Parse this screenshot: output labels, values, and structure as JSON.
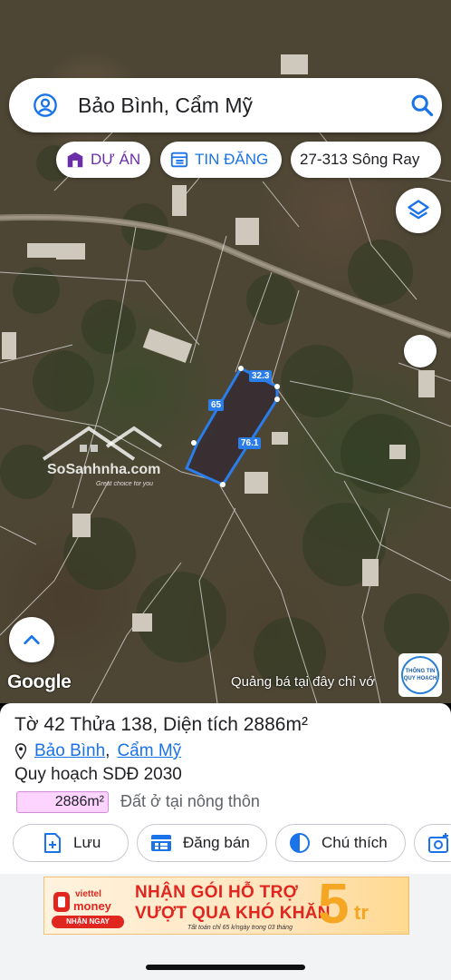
{
  "search": {
    "query": "Bảo Bình, Cẩm Mỹ"
  },
  "chips": {
    "du_an": "DỰ ÁN",
    "tin_dang": "TIN ĐĂNG",
    "address": "27-313 Sông Ray"
  },
  "map": {
    "google_label": "Google",
    "ad_text": "Quảng bá tại đây chỉ vớ",
    "badge_line1": "THÔNG TIN",
    "badge_line2": "QUY HOẠCH",
    "parcel_dims": {
      "top": "32.3",
      "left": "65",
      "right": "76.1"
    },
    "watermark_name": "SoSanhnha.com",
    "watermark_slogan": "Great choice for you",
    "parcel_color": "#2b7de9"
  },
  "parcel": {
    "title": "Tờ 42 Thửa 138, Diện tích 2886m²",
    "commune": "Bảo Bình",
    "separator": ",",
    "district": "Cẩm Mỹ",
    "plan_label": "Quy hoạch SDĐ 2030",
    "area_tag": "2886m²",
    "land_type": "Đất ở tại nông thôn",
    "area_tag_color": "#fcd4ff"
  },
  "actions": {
    "save": "Lưu",
    "post_sale": "Đăng bán",
    "legend": "Chú thích"
  },
  "banner": {
    "brand_line1": "viettel",
    "brand_line2": "money",
    "cta": "NHẬN NGAY",
    "line1": "NHẬN GÓI HỖ TRỢ",
    "line2": "VƯỢT QUA KHÓ KHĂN",
    "fine_print": "Tất toán chỉ 65 k/ngày trong 03 tháng",
    "amount": "5",
    "unit": "tr"
  }
}
